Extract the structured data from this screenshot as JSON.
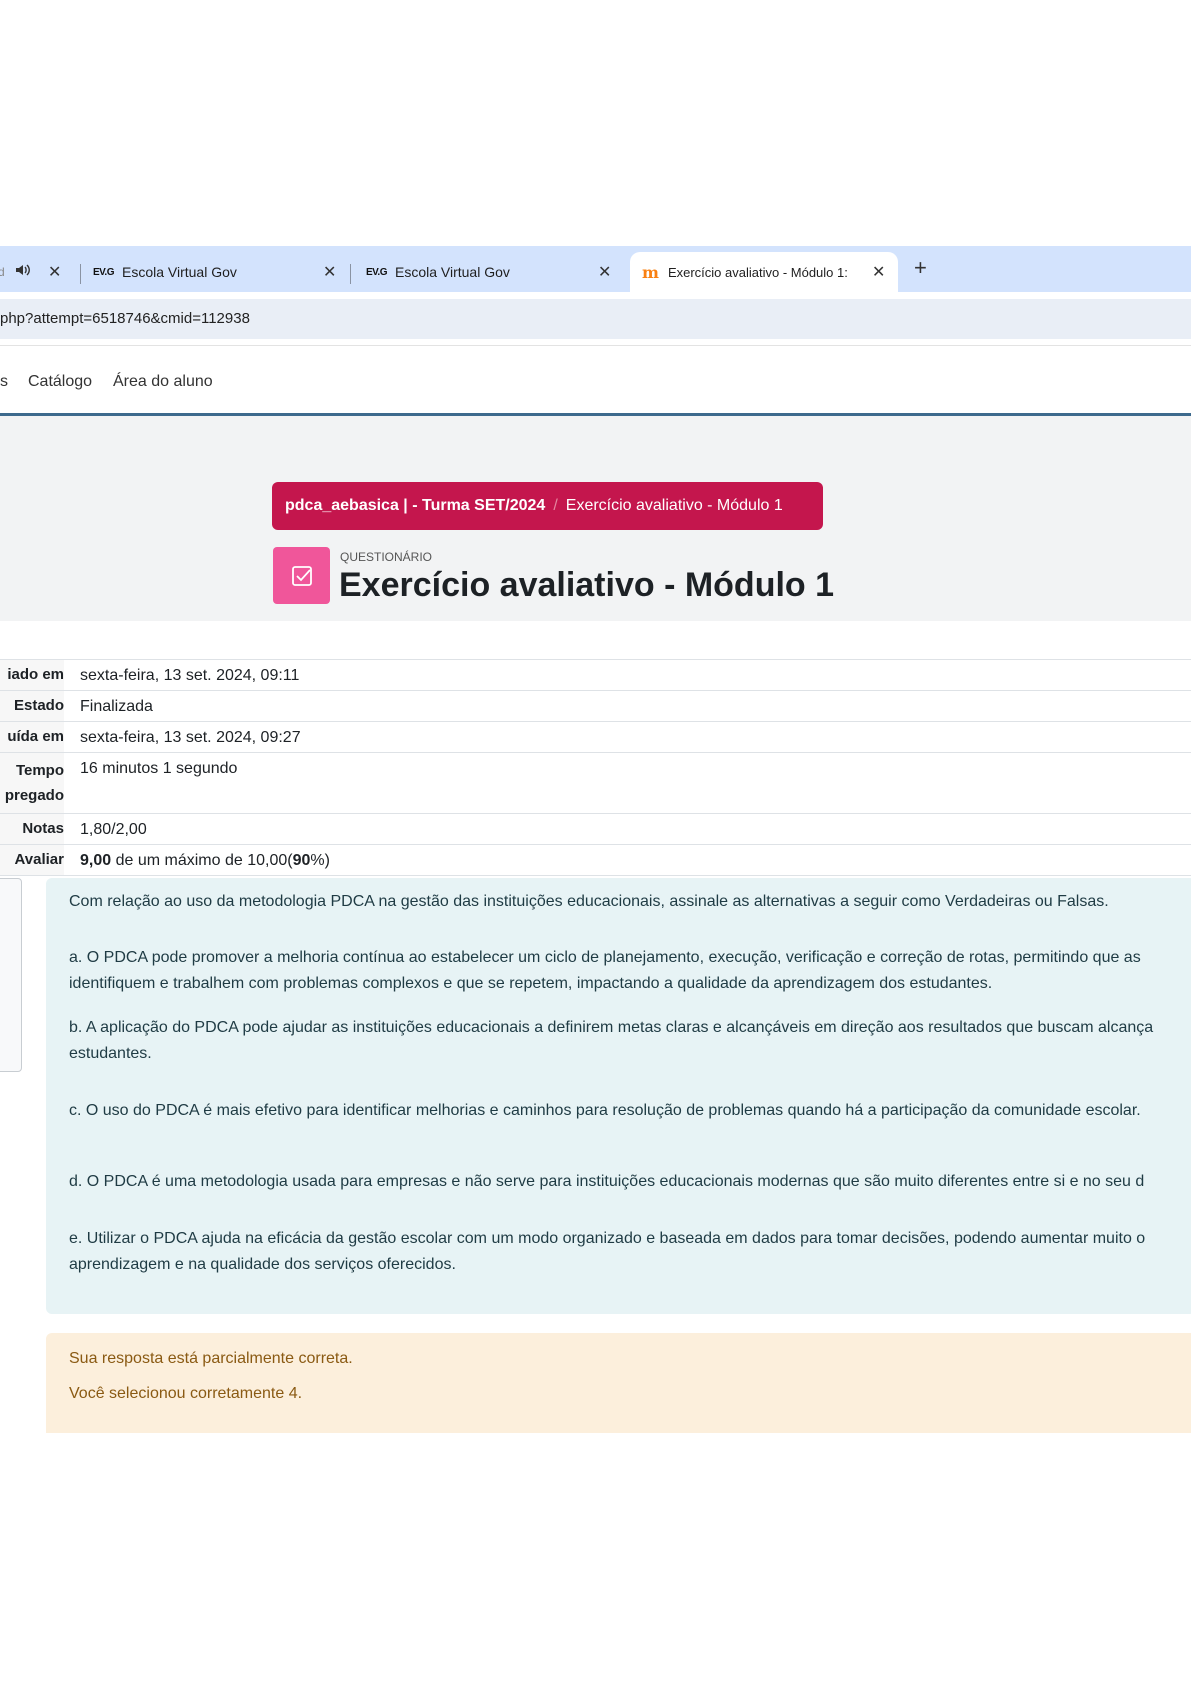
{
  "browser": {
    "tabs": [
      {
        "title": "d",
        "audio_icon": "speaker-icon"
      },
      {
        "favicon": "EV.G",
        "title": "Escola Virtual Gov"
      },
      {
        "favicon": "EV.G",
        "title": "Escola Virtual Gov"
      },
      {
        "favicon": "moodle-icon",
        "title": "Exercício avaliativo - Módulo 1:"
      }
    ],
    "close_glyph": "✕",
    "new_tab_glyph": "+",
    "url": "php?attempt=6518746&cmid=112938"
  },
  "site_nav": {
    "items": [
      "s",
      "Catálogo",
      "Área do aluno"
    ]
  },
  "header": {
    "breadcrumb": [
      "pdca_aebasica | - Turma SET/2024",
      "Exercício avaliativo - Módulo 1"
    ],
    "breadcrumb_separator": "/",
    "module_type": "QUESTIONÁRIO",
    "title": "Exercício avaliativo - Módulo 1"
  },
  "summary": {
    "rows": [
      {
        "label": "iado em",
        "value": "sexta-feira, 13 set. 2024, 09:11"
      },
      {
        "label": "Estado",
        "value": "Finalizada"
      },
      {
        "label": "uída em",
        "value": "sexta-feira, 13 set. 2024, 09:27"
      },
      {
        "label": "Tempo",
        "label2": "pregado",
        "value": "16 minutos 1 segundo"
      },
      {
        "label": "Notas",
        "value": "1,80/2,00"
      },
      {
        "label": "Avaliar",
        "grade": "9,00",
        "grade_mid": " de um máximo de 10,00(",
        "percent": "90",
        "grade_end": "%)"
      }
    ]
  },
  "question": {
    "intro": "Com relação ao uso da metodologia PDCA na gestão das instituições educacionais, assinale as alternativas a seguir como Verdadeiras ou Falsas.",
    "items": [
      [
        "a. O PDCA pode promover a melhoria contínua ao estabelecer um ciclo de planejamento, execução, verificação e correção de rotas, permitindo que as",
        "identifiquem e trabalhem com problemas complexos e que se repetem, impactando a qualidade da aprendizagem dos estudantes."
      ],
      [
        "b. A aplicação do PDCA pode ajudar as instituições educacionais a definirem metas claras e alcançáveis em direção aos resultados que buscam alcança",
        "estudantes."
      ],
      [
        "c. O uso do PDCA é mais efetivo para identificar melhorias e caminhos para resolução de problemas quando há a participação da comunidade escolar."
      ],
      [
        "d. O PDCA é uma metodologia usada para empresas e não serve para instituições educacionais modernas que são muito diferentes entre si e no seu d"
      ],
      [
        "e. Utilizar o PDCA ajuda na eficácia da gestão escolar com um modo organizado e baseada em dados para tomar decisões, podendo aumentar muito o",
        "aprendizagem e na qualidade dos serviços oferecidos."
      ]
    ]
  },
  "feedback": {
    "line1": "Sua resposta está parcialmente correta.",
    "line2": "Você selecionou corretamente 4."
  },
  "colors": {
    "breadcrumb_bg": "#c4164d",
    "activity_icon_bg": "#f0569a",
    "question_bg": "#e7f3f5",
    "feedback_bg": "#fcefdc"
  }
}
